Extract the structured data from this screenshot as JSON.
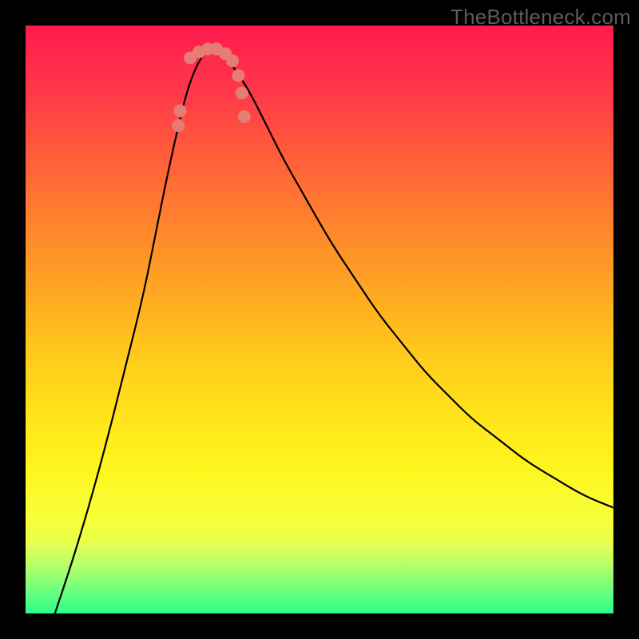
{
  "watermark": "TheBottleneck.com",
  "chart_data": {
    "type": "line",
    "title": "",
    "xlabel": "",
    "ylabel": "",
    "xlim": [
      0,
      100
    ],
    "ylim": [
      0,
      100
    ],
    "background_gradient": {
      "top_color": "#ff1a4f",
      "mid_colors": [
        "#ff7a2e",
        "#ffd81f",
        "#f6ff3f",
        "#d9ff60"
      ],
      "bottom_color": "#2cff8a",
      "green_band_start_pct": 88
    },
    "series": [
      {
        "name": "bottleneck-curve",
        "color": "#000000",
        "stroke_width": 2.2,
        "x": [
          5,
          8,
          11,
          14,
          17,
          20,
          22,
          24,
          26,
          27.5,
          29,
          30.5,
          32,
          33.5,
          35,
          38,
          41,
          44,
          48,
          52,
          56,
          60,
          64,
          68,
          72,
          76,
          80,
          85,
          90,
          95,
          100
        ],
        "y_pct": [
          0,
          9,
          19,
          30,
          42,
          54,
          64,
          74,
          83,
          89,
          93,
          95.5,
          96,
          95.5,
          93.5,
          89,
          83,
          77,
          70,
          63,
          57,
          51,
          46,
          41,
          37,
          33,
          30,
          26,
          23,
          20,
          18
        ]
      }
    ],
    "overlay_points": {
      "name": "data-points",
      "color": "#e57d74",
      "radius": 8,
      "points": [
        {
          "x": 26.0,
          "y_pct": 83
        },
        {
          "x": 26.3,
          "y_pct": 85.5
        },
        {
          "x": 28.0,
          "y_pct": 94.5
        },
        {
          "x": 29.5,
          "y_pct": 95.5
        },
        {
          "x": 31.0,
          "y_pct": 96
        },
        {
          "x": 32.5,
          "y_pct": 96
        },
        {
          "x": 34.0,
          "y_pct": 95.2
        },
        {
          "x": 35.2,
          "y_pct": 94
        },
        {
          "x": 36.2,
          "y_pct": 91.5
        },
        {
          "x": 36.8,
          "y_pct": 88.5
        },
        {
          "x": 37.2,
          "y_pct": 84.5
        }
      ]
    }
  }
}
